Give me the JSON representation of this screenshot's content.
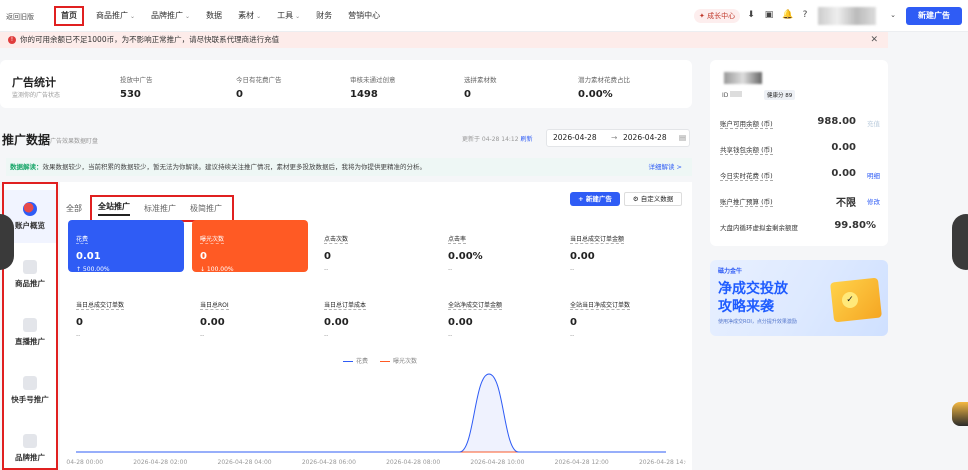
{
  "topbar": {
    "back": "返回旧版",
    "nav": [
      {
        "label": "首页",
        "active": true
      },
      {
        "label": "商品推广",
        "chevron": true
      },
      {
        "label": "品牌推广",
        "chevron": true
      },
      {
        "label": "数据"
      },
      {
        "label": "素材",
        "chevron": true
      },
      {
        "label": "工具",
        "chevron": true
      },
      {
        "label": "财务"
      },
      {
        "label": "营销中心"
      }
    ],
    "growth": "成长中心",
    "new_ad": "新建广告"
  },
  "alert": {
    "text": "你的可用余额已不足1000币，为不影响正常推广，请尽快联系代理商进行充值"
  },
  "stats": {
    "title": "广告统计",
    "sub": "监测你的广告状态",
    "items": [
      {
        "label": "投放中广告",
        "value": "530"
      },
      {
        "label": "今日有花费广告",
        "value": "0"
      },
      {
        "label": "审核未通过创意",
        "value": "1498"
      },
      {
        "label": "选拼素材数",
        "value": "0"
      },
      {
        "label": "潜力素材花费占比",
        "value": "0.00%"
      }
    ]
  },
  "section": {
    "title": "推广数据",
    "sub": "广告效果数据盯盘",
    "updated": "更新于 04-28 14:12",
    "refresh": "刷新",
    "date_start": "2026-04-28",
    "date_sep": "→",
    "date_end": "2026-04-28"
  },
  "tip": {
    "tag": "数据解读：",
    "text": "效果数据较少，当前积累的数据较少，暂无法为你解读。建议持续关注推广情况，素材更多投放数据后，我将为你提供更精准的分析。",
    "more": "详细解读 >"
  },
  "sidebar": [
    {
      "label": "账户概览",
      "active": true
    },
    {
      "label": "商品推广"
    },
    {
      "label": "直播推广"
    },
    {
      "label": "快手号推广"
    },
    {
      "label": "品牌推广"
    }
  ],
  "tabs": {
    "all": "全部",
    "items": [
      {
        "label": "全站推广",
        "active": true
      },
      {
        "label": "标准推广"
      },
      {
        "label": "极简推广"
      }
    ],
    "new_btn": "+ 新建广告",
    "custom_btn": "自定义数据"
  },
  "cards": [
    {
      "label": "花费",
      "value": "0.01",
      "delta": "↑ 500.00%"
    },
    {
      "label": "曝光次数",
      "value": "0",
      "delta": "↓ 100.00%"
    },
    {
      "label": "点击次数",
      "value": "0",
      "delta": "--"
    },
    {
      "label": "点击率",
      "value": "0.00%",
      "delta": "--"
    },
    {
      "label": "当日总成交订单金额",
      "value": "0.00",
      "delta": "--"
    },
    {
      "label": "当日总成交订单数",
      "value": "0",
      "delta": "--"
    },
    {
      "label": "当日总ROI",
      "value": "0.00",
      "delta": "--"
    },
    {
      "label": "当日总订单成本",
      "value": "0.00",
      "delta": "--"
    },
    {
      "label": "全站净成交订单金额",
      "value": "0.00",
      "delta": "--"
    },
    {
      "label": "全站当日净成交订单数",
      "value": "0",
      "delta": "--"
    }
  ],
  "chart_data": {
    "type": "line",
    "series": [
      {
        "name": "花费",
        "color": "#2f5cf5",
        "values": [
          0,
          0,
          0,
          0,
          0,
          0,
          0,
          0,
          0,
          0,
          0,
          0,
          0,
          0,
          0.01,
          0,
          0,
          0,
          0,
          0,
          0
        ]
      },
      {
        "name": "曝光次数",
        "color": "#ff5a24",
        "values": [
          0,
          0,
          0,
          0,
          0,
          0,
          0,
          0,
          0,
          0,
          0,
          0,
          0,
          0,
          0,
          0,
          0,
          0,
          0,
          0,
          0
        ]
      }
    ],
    "x_ticks": [
      "2026-04-28 00:00",
      "2026-04-28 02:00",
      "2026-04-28 04:00",
      "2026-04-28 06:00",
      "2026-04-28 08:00",
      "2026-04-28 10:00",
      "2026-04-28 12:00",
      "2026-04-28 14:00"
    ],
    "grid": false,
    "legend": "top-center"
  },
  "account": {
    "id_label": "ID",
    "health": "健康分 89",
    "rows": [
      {
        "label": "账户可用余额 (币)",
        "value": "988.00",
        "link": "充值"
      },
      {
        "label": "共享钱包余额 (币)",
        "value": "0.00",
        "link": ""
      },
      {
        "label": "今日实时花费 (币)",
        "value": "0.00",
        "link": "明细"
      },
      {
        "label": "账户推广预算 (币)",
        "value": "不限",
        "link": "修改"
      },
      {
        "label": "大盘内循环虚拟金剩余额度",
        "value": "99.80%",
        "link": ""
      }
    ]
  },
  "banner": {
    "brand": "磁力金牛",
    "title_line1": "净成交投放",
    "title_line2": "攻略来袭",
    "sub": "使用净成交ROI，点分提升效果激励"
  }
}
